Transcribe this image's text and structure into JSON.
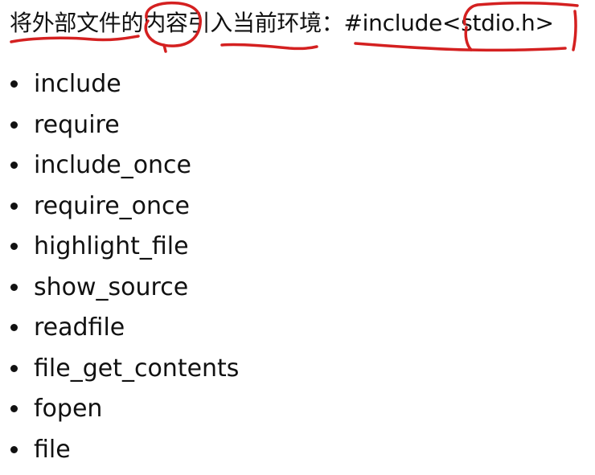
{
  "heading": {
    "chinese_text": "将外部文件的内容引入当前环境：",
    "code_text": "#include",
    "header_open": "<",
    "header_name": "stdio.h",
    "header_close": ">"
  },
  "functions": [
    "include",
    "require",
    "include_once",
    "require_once",
    "highlight_file",
    "show_source",
    "readfile",
    "file_get_contents",
    "fopen",
    "file"
  ],
  "annotation_color": "#d42020"
}
